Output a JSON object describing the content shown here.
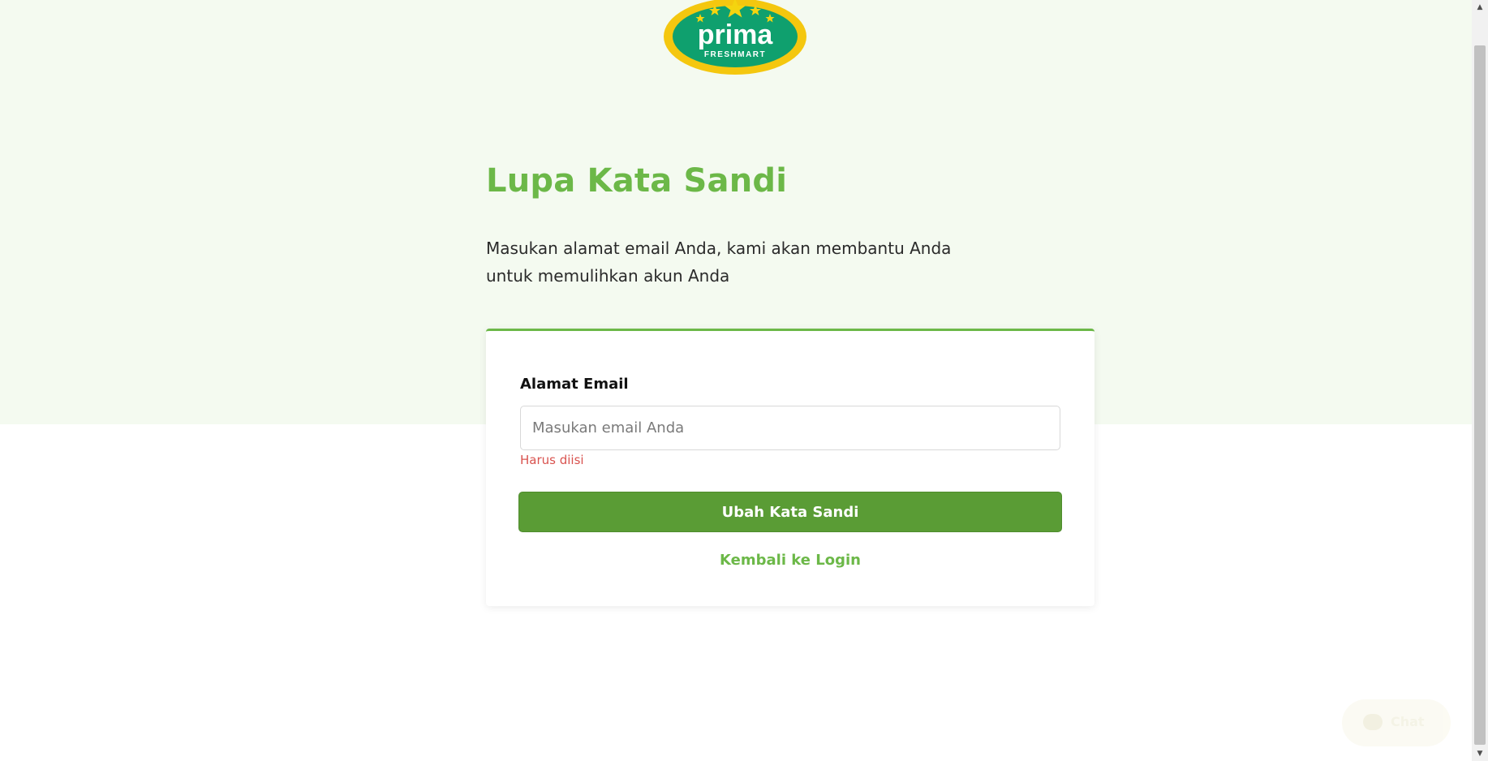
{
  "brand": {
    "logo_name": "prima",
    "logo_sub": "FRESHMART",
    "colors": {
      "green_ring": "#0fa06e",
      "yellow_ring": "#f4c70f",
      "accent": "#6cb848",
      "button": "#5a9c35"
    }
  },
  "page": {
    "title": "Lupa Kata Sandi",
    "subtitle_line1": "Masukan alamat email Anda, kami akan membantu Anda",
    "subtitle_line2": "untuk memulihkan akun Anda"
  },
  "form": {
    "email_label": "Alamat Email",
    "email_value": "",
    "email_placeholder": "Masukan email Anda",
    "error": "Harus diisi",
    "submit_label": "Ubah Kata Sandi",
    "back_label": "Kembali ke Login"
  },
  "chat": {
    "label": "Chat",
    "icon": "chat-bubble-icon"
  }
}
